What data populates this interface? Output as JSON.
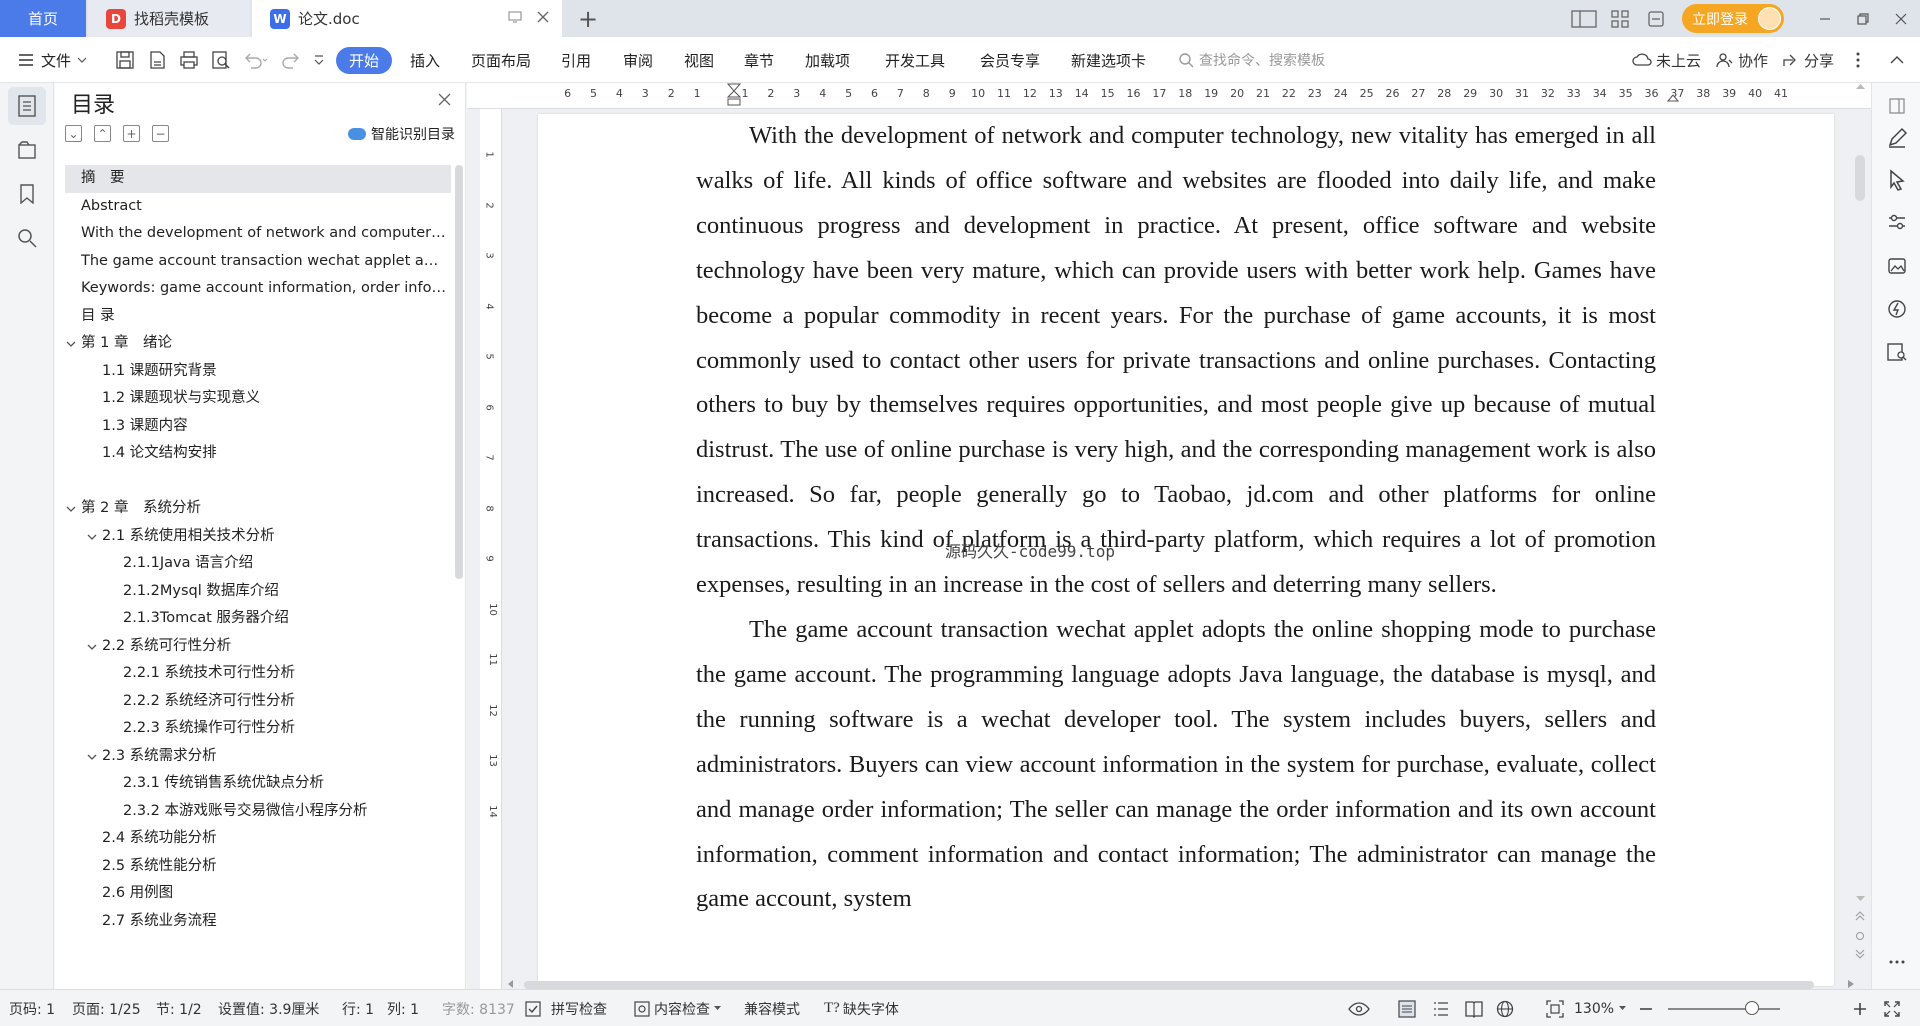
{
  "tabs": {
    "home": "首页",
    "templates": "找稻壳模板",
    "doc": "论文.doc"
  },
  "topbar": {
    "login": "立即登录"
  },
  "ribbon": {
    "file": "文件",
    "menu": [
      "开始",
      "插入",
      "页面布局",
      "引用",
      "审阅",
      "视图",
      "章节",
      "加载项",
      "开发工具",
      "会员专享",
      "新建选项卡"
    ],
    "search_placeholder": "查找命令、搜索模板",
    "cloud": "未上云",
    "collab": "协作",
    "share": "分享"
  },
  "toc": {
    "title": "目录",
    "smart_label": "智能识别目录",
    "items": [
      {
        "label": "摘　要",
        "level": 1,
        "selected": true
      },
      {
        "label": "Abstract",
        "level": 1
      },
      {
        "label": "With the development of network and computer technology, new vitality has emerged in all walks of life.",
        "level": 1
      },
      {
        "label": "The game account transaction wechat applet adopts the online shopping mode",
        "level": 1
      },
      {
        "label": "Keywords: game account information, order information, online shopping",
        "level": 1
      },
      {
        "label": "目 录",
        "level": 1
      },
      {
        "label": "第 1 章　绪论",
        "level": 1,
        "expanded": true
      },
      {
        "label": "1.1 课题研究背景",
        "level": 2
      },
      {
        "label": "1.2 课题现状与实现意义",
        "level": 2
      },
      {
        "label": "1.3 课题内容",
        "level": 2
      },
      {
        "label": "1.4 论文结构安排",
        "level": 2
      },
      {
        "label": "",
        "level": 1
      },
      {
        "label": "第 2 章　系统分析",
        "level": 1,
        "expanded": true
      },
      {
        "label": "2.1 系统使用相关技术分析",
        "level": 2,
        "expanded": true
      },
      {
        "label": "2.1.1Java 语言介绍",
        "level": 3
      },
      {
        "label": "2.1.2Mysql 数据库介绍",
        "level": 3
      },
      {
        "label": "2.1.3Tomcat 服务器介绍",
        "level": 3
      },
      {
        "label": "2.2 系统可行性分析",
        "level": 2,
        "expanded": true
      },
      {
        "label": "2.2.1 系统技术可行性分析",
        "level": 3
      },
      {
        "label": "2.2.2 系统经济可行性分析",
        "level": 3
      },
      {
        "label": "2.2.3 系统操作可行性分析",
        "level": 3
      },
      {
        "label": "2.3 系统需求分析",
        "level": 2,
        "expanded": true
      },
      {
        "label": "2.3.1 传统销售系统优缺点分析",
        "level": 3
      },
      {
        "label": "2.3.2 本游戏账号交易微信小程序分析",
        "level": 3
      },
      {
        "label": "2.4 系统功能分析",
        "level": 2
      },
      {
        "label": "2.5 系统性能分析",
        "level": 2
      },
      {
        "label": "2.6 用例图",
        "level": 2
      },
      {
        "label": "2.7 系统业务流程",
        "level": 2
      }
    ]
  },
  "ruler": {
    "h_left": [
      "6",
      "5",
      "4",
      "3",
      "2",
      "1"
    ],
    "h_right": [
      "1",
      "2",
      "3",
      "4",
      "5",
      "6",
      "7",
      "8",
      "9",
      "10",
      "11",
      "12",
      "13",
      "14",
      "15",
      "16",
      "17",
      "18",
      "19",
      "20",
      "21",
      "22",
      "23",
      "24",
      "25",
      "26",
      "27",
      "28",
      "29",
      "30",
      "31",
      "32",
      "33",
      "34",
      "35",
      "36",
      "37",
      "38",
      "39",
      "40",
      "41"
    ],
    "v": [
      "1",
      "2",
      "3",
      "4",
      "5",
      "6",
      "7",
      "8",
      "9",
      "10",
      "11",
      "12",
      "13",
      "14"
    ]
  },
  "document": {
    "paragraphs": [
      "With the development of network and computer technology, new vitality has emerged in all walks of life. All kinds of office software and websites are flooded into daily life, and make continuous progress and development in practice. At present, office software and website technology have been very mature, which can provide users with better work help. Games have become a popular commodity in recent years. For the purchase of game accounts, it is most commonly used to contact other users for private transactions and online purchases. Contacting others to buy by themselves requires opportunities, and most people give up because of mutual distrust. The use of online purchase is very high, and the corresponding management work is also increased. So far, people generally go to Taobao, jd.com and other platforms for online transactions. This kind of platform is a third-party platform, which requires a lot of promotion expenses, resulting in an increase in the cost of sellers and deterring many sellers.",
      "The game account transaction wechat applet adopts the online shopping mode to purchase the game account. The programming language adopts Java language, the database is mysql, and the running software is a wechat developer tool. The system includes buyers, sellers and administrators. Buyers can view account information in the system for purchase, evaluate, collect and manage order information; The seller can manage the order information and its own account information, comment information and contact information; The administrator can manage the game account, system"
    ],
    "watermark": "源码久久-code99.top"
  },
  "status": {
    "page": "页码: 1",
    "pages": "页面: 1/25",
    "section": "节: 1/2",
    "setting": "设置值: 3.9厘米",
    "row": "行: 1",
    "col": "列: 1",
    "words": "字数: 8137",
    "spell": "拼写检查",
    "content_check": "内容检查",
    "compat": "兼容模式",
    "missing_font": "缺失字体",
    "zoom": "130%",
    "zoom_level": 0.75
  },
  "colors": {
    "accent": "#4a7be8",
    "login": "#f5a623"
  }
}
